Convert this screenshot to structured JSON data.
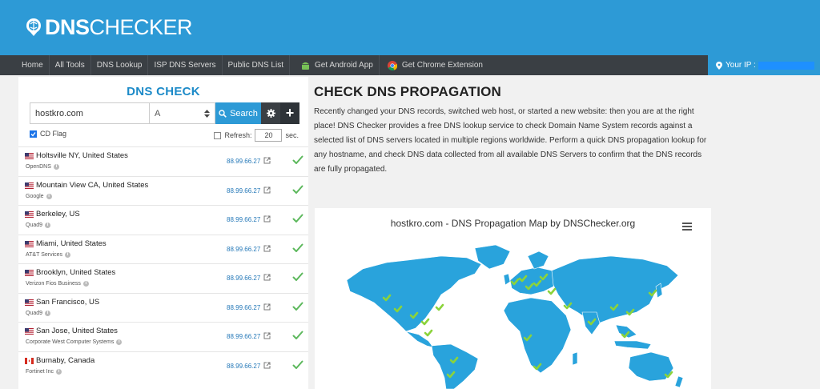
{
  "header": {
    "logo_bold": "DNS",
    "logo_light": "CHECKER"
  },
  "nav": {
    "items": [
      "Home",
      "All Tools",
      "DNS Lookup",
      "ISP DNS Servers",
      "Public DNS List",
      "Get Android App",
      "Get Chrome Extension"
    ],
    "your_ip_label": "Your IP :"
  },
  "check": {
    "title": "DNS CHECK",
    "host_value": "hostkro.com",
    "record_type": "A",
    "search_label": "Search",
    "cd_flag_label": "CD Flag",
    "refresh_label": "Refresh:",
    "refresh_value": "20",
    "refresh_unit": "sec."
  },
  "results": [
    {
      "flag": "us",
      "location": "Holtsville NY, United States",
      "provider": "OpenDNS",
      "ip": "88.99.66.27",
      "status": "ok"
    },
    {
      "flag": "us",
      "location": "Mountain View CA, United States",
      "provider": "Google",
      "ip": "88.99.66.27",
      "status": "ok"
    },
    {
      "flag": "us",
      "location": "Berkeley, US",
      "provider": "Quad9",
      "ip": "88.99.66.27",
      "status": "ok"
    },
    {
      "flag": "us",
      "location": "Miami, United States",
      "provider": "AT&T Services",
      "ip": "88.99.66.27",
      "status": "ok"
    },
    {
      "flag": "us",
      "location": "Brooklyn, United States",
      "provider": "Verizon Fios Business",
      "ip": "88.99.66.27",
      "status": "ok"
    },
    {
      "flag": "us",
      "location": "San Francisco, US",
      "provider": "Quad9",
      "ip": "88.99.66.27",
      "status": "ok"
    },
    {
      "flag": "us",
      "location": "San Jose, United States",
      "provider": "Corporate West Computer Systems",
      "ip": "88.99.66.27",
      "status": "ok"
    },
    {
      "flag": "ca",
      "location": "Burnaby, Canada",
      "provider": "Fortinet Inc",
      "ip": "88.99.66.27",
      "status": "ok"
    }
  ],
  "propagation": {
    "title": "CHECK DNS PROPAGATION",
    "description": "Recently changed your DNS records, switched web host, or started a new website: then you are at the right place! DNS Checker provides a free DNS lookup service to check Domain Name System records against a selected list of DNS servers located in multiple regions worldwide. Perform a quick DNS propagation lookup for any hostname, and check DNS data collected from all available DNS Servers to confirm that the DNS records are fully propagated.",
    "map_title": "hostkro.com - DNS Propagation Map by DNSChecker.org"
  },
  "colors": {
    "brand": "#2d9ad6",
    "nav": "#3a3f44",
    "map_land": "#29a3dc",
    "check": "#5cb85c"
  }
}
